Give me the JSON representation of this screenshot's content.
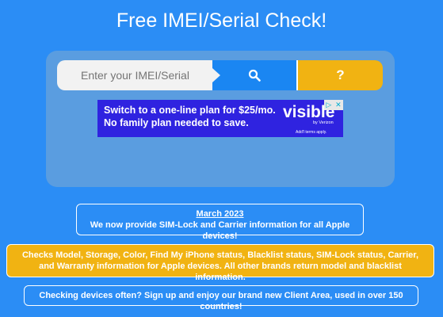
{
  "page": {
    "title": "Free IMEI/Serial Check!"
  },
  "search": {
    "placeholder": "Enter your IMEI/Serial",
    "help_label": "?"
  },
  "icons": {
    "search": "search-icon"
  },
  "ad": {
    "line1": "Switch to a one-line plan for $25/mo.",
    "line2": "No family plan needed to save.",
    "brand": "visible",
    "brand_sub": "by Verizon",
    "terms": "Add'l terms apply."
  },
  "notices": {
    "news_date": "March 2023",
    "news_text": "We now provide SIM-Lock and Carrier information for all Apple devices!",
    "features_text": "Checks Model, Storage, Color, Find My iPhone status, Blacklist status, SIM-Lock status, Carrier, and Warranty information for Apple devices. All other brands return model and blacklist information.",
    "signup_text": "Checking devices often? Sign up and enjoy our brand new Client Area, used in over 150 countries!"
  },
  "colors": {
    "background": "#2b8df5",
    "panel": "#5a9de0",
    "accent_blue": "#1a86f2",
    "accent_yellow": "#f1b312"
  }
}
